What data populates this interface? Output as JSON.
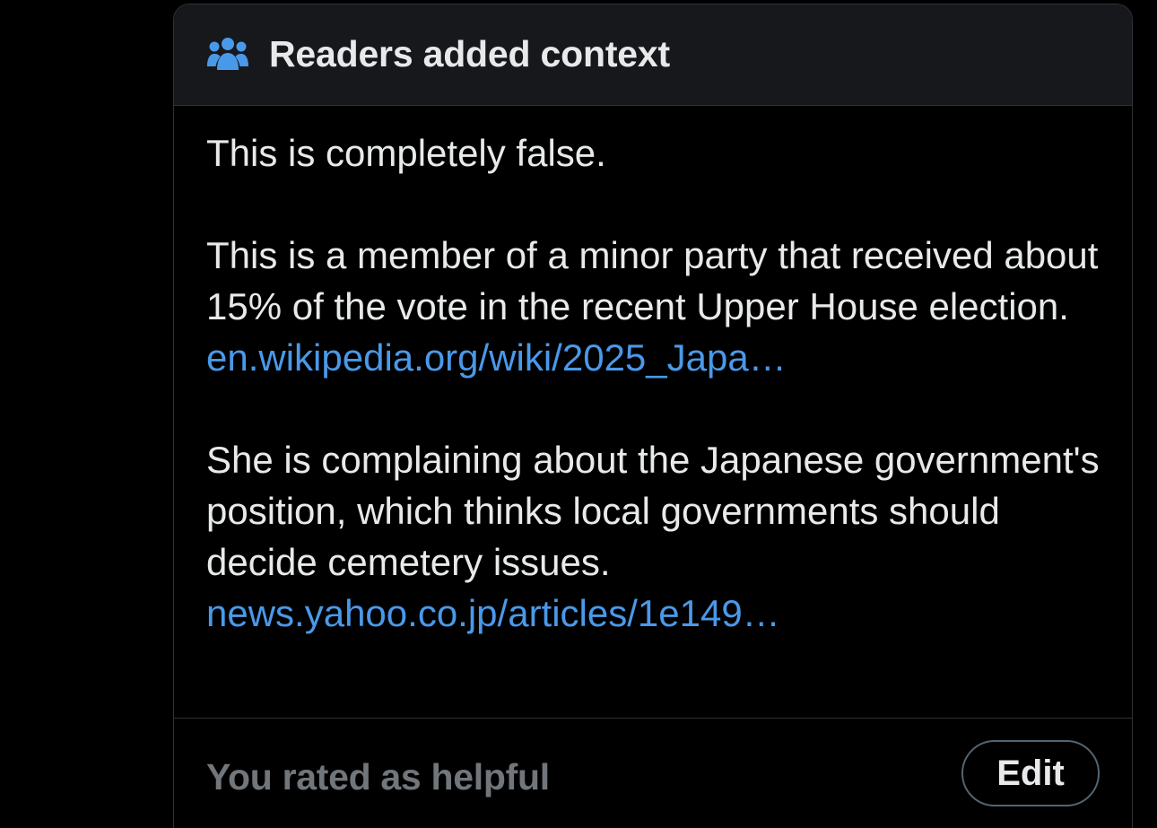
{
  "note": {
    "header": {
      "icon": "people-icon",
      "title": "Readers added context"
    },
    "body": {
      "paragraph_1": "This is completely false.",
      "paragraph_2": "This is a member of a minor party that received about 15% of the vote in the recent Upper House election.",
      "link_1": "en.wikipedia.org/wiki/2025_Japa…",
      "paragraph_3": "She is complaining about the Japanese government's position, which thinks local governments should decide cemetery issues.",
      "link_2": "news.yahoo.co.jp/articles/1e149…"
    },
    "footer": {
      "rating_text": "You rated as helpful",
      "edit_label": "Edit"
    }
  },
  "colors": {
    "background": "#000000",
    "header_background": "#16181c",
    "text": "#e7e9ea",
    "muted_text": "#71767b",
    "link": "#4a99e9",
    "icon": "#4a99e9",
    "border": "#2f3336"
  }
}
